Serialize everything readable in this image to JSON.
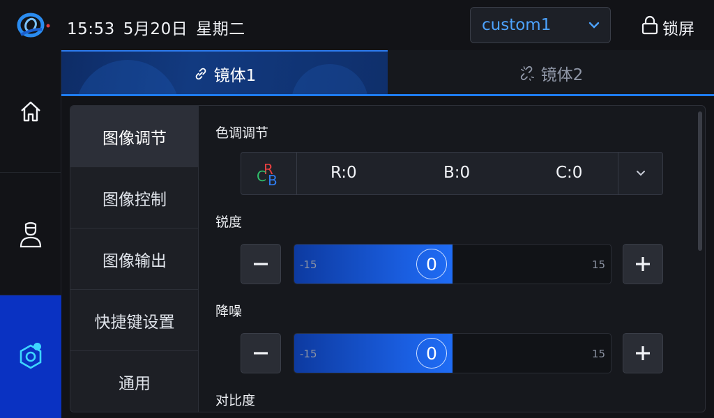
{
  "header": {
    "time": "15:53",
    "date": "5月20日",
    "weekday": "星期二",
    "preset": {
      "selected": "custom1"
    },
    "lock_label": "锁屏"
  },
  "nav": {
    "items": [
      {
        "icon": "home-icon",
        "active": false
      },
      {
        "icon": "doctor-icon",
        "active": false
      },
      {
        "icon": "settings-hex-icon",
        "active": true
      }
    ]
  },
  "scope_tabs": [
    {
      "label": "镜体1",
      "icon": "link-icon",
      "active": true
    },
    {
      "label": "镜体2",
      "icon": "link-broken-icon",
      "active": false
    }
  ],
  "menu": {
    "items": [
      {
        "label": "图像调节",
        "active": true
      },
      {
        "label": "图像控制",
        "active": false
      },
      {
        "label": "图像输出",
        "active": false
      },
      {
        "label": "快捷键设置",
        "active": false
      },
      {
        "label": "通用",
        "active": false
      }
    ]
  },
  "settings": {
    "tone": {
      "title": "色调调节",
      "icon_letters": {
        "r": "R",
        "c": "C",
        "b": "B"
      },
      "values": {
        "r": "R:0",
        "b": "B:0",
        "c": "C:0"
      }
    },
    "sharpness": {
      "title": "锐度",
      "value": "0",
      "min": "-15",
      "max": "15",
      "fill": 0.5
    },
    "denoise": {
      "title": "降噪",
      "value": "0",
      "min": "-15",
      "max": "15",
      "fill": 0.5
    },
    "contrast": {
      "title": "对比度"
    }
  },
  "colors": {
    "accent": "#1e7cf0",
    "nav_active": "#0a32c2",
    "preset_text": "#4da3ff",
    "cyan_dot": "#3dd6ff"
  }
}
